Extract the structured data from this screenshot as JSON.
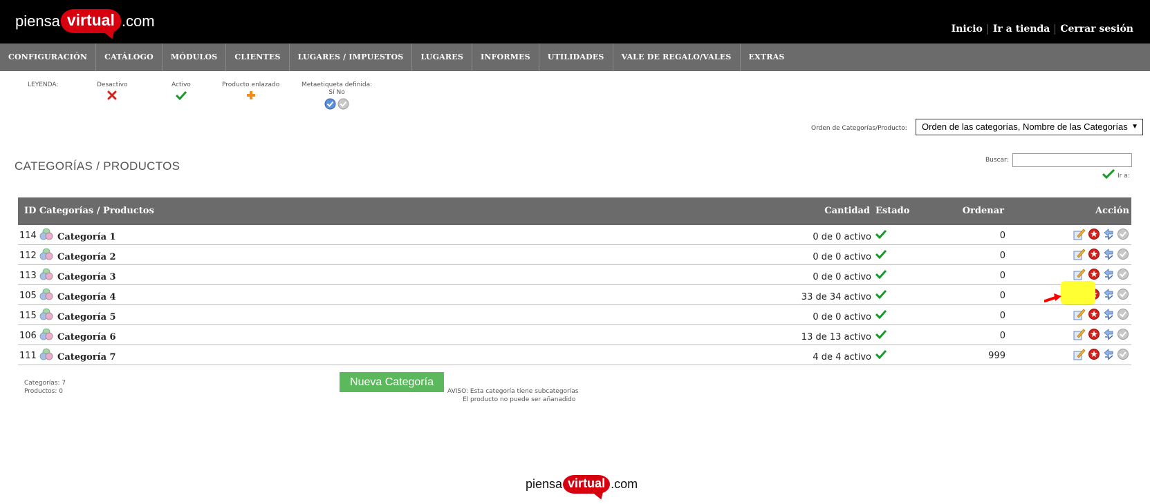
{
  "header": {
    "logo": {
      "pre": "piensa",
      "mid": "virtual",
      "post": ".com"
    },
    "links": [
      "Inicio",
      "Ir a tienda",
      "Cerrar sesión"
    ]
  },
  "nav": [
    "CONFIGURACIÓN",
    "CATÁLOGO",
    "MÓDULOS",
    "CLIENTES",
    "LUGARES / IMPUESTOS",
    "LUGARES",
    "INFORMES",
    "UTILIDADES",
    "VALE DE REGALO/VALES",
    "EXTRAS"
  ],
  "legend": {
    "title": "LEYENDA:",
    "inactive": "Desactivo",
    "active": "Activo",
    "linked": "Producto enlazado",
    "meta": "Metaetiqueta definida:",
    "meta_yes_no": "Sí No"
  },
  "sort": {
    "label": "Orden de Categorías/Producto:",
    "selected": "Orden de las categorías, Nombre de las Categorías"
  },
  "page_title": "CATEGORÍAS / PRODUCTOS",
  "search": {
    "label": "Buscar:",
    "value": "",
    "go_label": "Ir a:"
  },
  "table": {
    "headers": {
      "id_name": "ID Categorías / Productos",
      "qty": "Cantidad",
      "status": "Estado",
      "order": "Ordenar",
      "action": "Acción"
    },
    "rows": [
      {
        "id": "114",
        "name": "Categoría 1",
        "qty": "0 de 0 activo",
        "order": "0"
      },
      {
        "id": "112",
        "name": "Categoría 2",
        "qty": "0 de 0 activo",
        "order": "0"
      },
      {
        "id": "113",
        "name": "Categoría 3",
        "qty": "0 de 0 activo",
        "order": "0"
      },
      {
        "id": "105",
        "name": "Categoría 4",
        "qty": "33 de 34 activo",
        "order": "0"
      },
      {
        "id": "115",
        "name": "Categoría 5",
        "qty": "0 de 0 activo",
        "order": "0"
      },
      {
        "id": "106",
        "name": "Categoría 6",
        "qty": "13 de 13 activo",
        "order": "0"
      },
      {
        "id": "111",
        "name": "Categoría 7",
        "qty": "4 de 4 activo",
        "order": "999"
      }
    ]
  },
  "stats": {
    "categories": "Categorías: 7",
    "products": "Productos: 0"
  },
  "new_button": "Nueva Categoría",
  "notice": {
    "line1": "AVISO: Esta categoría tiene subcategorías",
    "line2": "El producto no puede ser añanadido"
  },
  "colors": {
    "header_bg": "#000000",
    "nav_bg": "#6b6b6b",
    "brand_red": "#d6000f",
    "button_green": "#5cb85c",
    "check_green": "#1a9a2a",
    "highlight": "#ffff33",
    "pointer_red": "#ff0000"
  }
}
